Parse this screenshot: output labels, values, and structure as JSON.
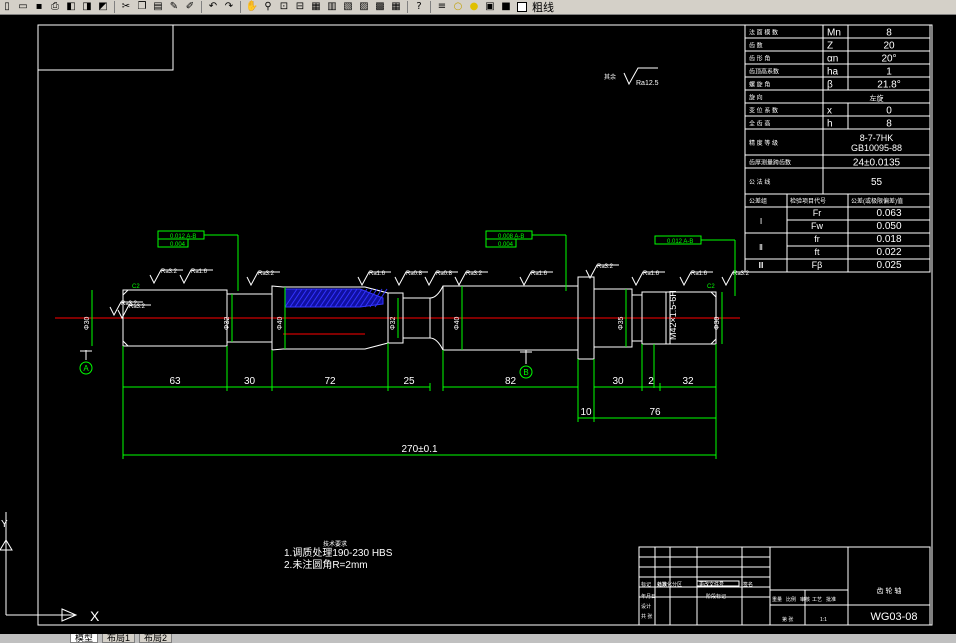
{
  "toolbar": {
    "icons": [
      "new-icon",
      "open-icon",
      "save-icon",
      "print-icon",
      "preview-icon",
      "publish-icon",
      "plot-icon",
      "cut-icon",
      "copy-icon",
      "paste-icon",
      "match-props-icon",
      "brush-icon",
      "undo-icon",
      "redo-icon",
      "pan-icon",
      "zoom-realtime-icon",
      "zoom-window-icon",
      "zoom-previous-icon",
      "properties-icon",
      "design-center-icon",
      "tool-palettes-icon",
      "sheet-set-icon",
      "markup-icon",
      "calculator-icon",
      "help-icon",
      "layer-icon",
      "bulb-icon",
      "sun-icon",
      "lock-icon",
      "color-icon"
    ],
    "layer_name": "粗线"
  },
  "params": [
    [
      "法 面 模 数",
      "Mn",
      "8"
    ],
    [
      "齿 数",
      "Z",
      "20"
    ],
    [
      "齿 形 角",
      "αn",
      "20°"
    ],
    [
      "齿顶高系数",
      "ha",
      "1"
    ],
    [
      "螺 旋 角",
      "β",
      "21.8°"
    ],
    [
      "旋 向",
      "",
      "左旋"
    ],
    [
      "变 位 系 数",
      "x",
      "0"
    ],
    [
      "全 齿 高",
      "h",
      "8"
    ],
    [
      "精 度 等 级",
      "",
      "8-7-7HK GB10095-88"
    ],
    [
      "齿厚测量跨齿数",
      "",
      "24±0.0135"
    ],
    [
      "公 法 线",
      "",
      "55"
    ]
  ],
  "tolerance_header": [
    "公差组",
    "检验项目代号",
    "公差(或极限偏差)值"
  ],
  "tolerances": [
    [
      "Ⅰ",
      "Fr",
      "0.063"
    ],
    [
      "",
      "Fw",
      "0.050"
    ],
    [
      "Ⅱ",
      "fr",
      "0.018"
    ],
    [
      "",
      "ft",
      "0.022"
    ],
    [
      "Ⅲ",
      "Fβ",
      "0.025"
    ]
  ],
  "roughness_others": [
    "其余",
    "Ra12.5"
  ],
  "roughness_labels": [
    "Ra3.2",
    "Ra1.6",
    "Ra3.2",
    "Ra1.6",
    "Ra0.8",
    "Ra0.8",
    "Ra3.2",
    "Ra1.6",
    "Ra3.2",
    "Ra1.6",
    "Ra1.6",
    "Ra3.2",
    "Ra3.2"
  ],
  "gtol_labels": [
    "0.012 A-B",
    "0.004",
    "0.008 A-B",
    "0.004",
    "0.012 A-B"
  ],
  "chamfers": [
    "C2",
    "C2"
  ],
  "datums": [
    "A",
    "B"
  ],
  "dims": {
    "d1": "63",
    "d2": "30",
    "d3": "72",
    "d4": "25",
    "d5": "82",
    "d6": "30",
    "d7": "2",
    "d8": "32",
    "d9": "10",
    "d10": "76",
    "total": "270±0.1"
  },
  "thread": "M42×1.5-6H",
  "diameter_labels": [
    "Φ30",
    "Φ32",
    "Φ40",
    "Φ32",
    "Φ40",
    "Φ35",
    "Φ30"
  ],
  "notes": {
    "title": "技术要求",
    "line1": "1.调质处理190-230 HBS",
    "line2": "2.未注圆角R=2mm"
  },
  "title_block": {
    "part_name": "齿 轮 轴",
    "drawing_no": "WG03-08",
    "cells": [
      "标记",
      "处数",
      "分区",
      "更改文件号",
      "签名",
      "年月日",
      "设计",
      "标准化",
      "阶段标记",
      "重量",
      "比例",
      "审核",
      "工艺",
      "批准",
      "共 张",
      "第 张",
      "1:1"
    ]
  },
  "ucs": {
    "x": "X",
    "y": "Y"
  },
  "tabs": [
    "模型",
    "布局1",
    "布局2"
  ]
}
